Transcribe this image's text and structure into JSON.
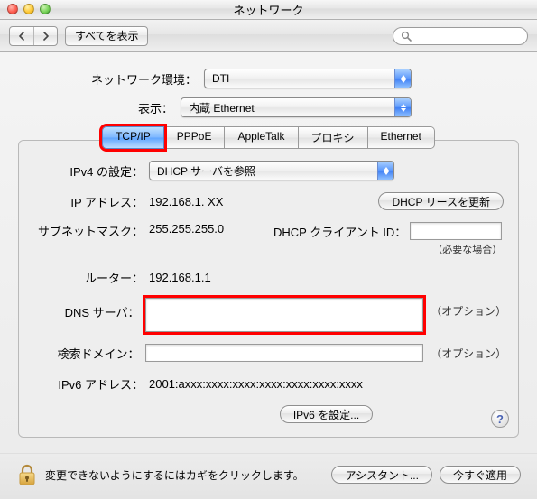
{
  "window": {
    "title": "ネットワーク"
  },
  "toolbar": {
    "show_all_label": "すべてを表示",
    "search_placeholder": ""
  },
  "selectors": {
    "location_label": "ネットワーク環境：",
    "location_value": "DTI",
    "show_label": "表示：",
    "show_value": "内蔵 Ethernet"
  },
  "tabs": {
    "tcpip": "TCP/IP",
    "pppoe": "PPPoE",
    "appletalk": "AppleTalk",
    "proxy": "プロキシ",
    "ethernet": "Ethernet"
  },
  "tcpip": {
    "ipv4_config_label": "IPv4 の設定：",
    "ipv4_config_value": "DHCP サーバを参照",
    "ip_label": "IP アドレス：",
    "ip_value": "192.168.1. XX",
    "renew_lease_label": "DHCP リースを更新",
    "subnet_label": "サブネットマスク：",
    "subnet_value": "255.255.255.0",
    "dhcp_client_label": "DHCP クライアント ID：",
    "dhcp_client_note": "（必要な場合）",
    "router_label": "ルーター：",
    "router_value": "192.168.1.1",
    "dns_label": "DNS サーバ：",
    "dns_hint": "（オプション）",
    "search_domains_label": "検索ドメイン：",
    "search_domains_hint": "（オプション）",
    "ipv6_label": "IPv6 アドレス：",
    "ipv6_value": "2001:axxx:xxxx:xxxx:xxxx:xxxx:xxxx:xxxx",
    "ipv6_config_label": "IPv6 を設定..."
  },
  "bottom": {
    "lock_text": "変更できないようにするにはカギをクリックします。",
    "assistant_label": "アシスタント...",
    "apply_label": "今すぐ適用"
  },
  "colors": {
    "highlight": "#ff0000",
    "aqua_blue": "#5fa5ff"
  }
}
